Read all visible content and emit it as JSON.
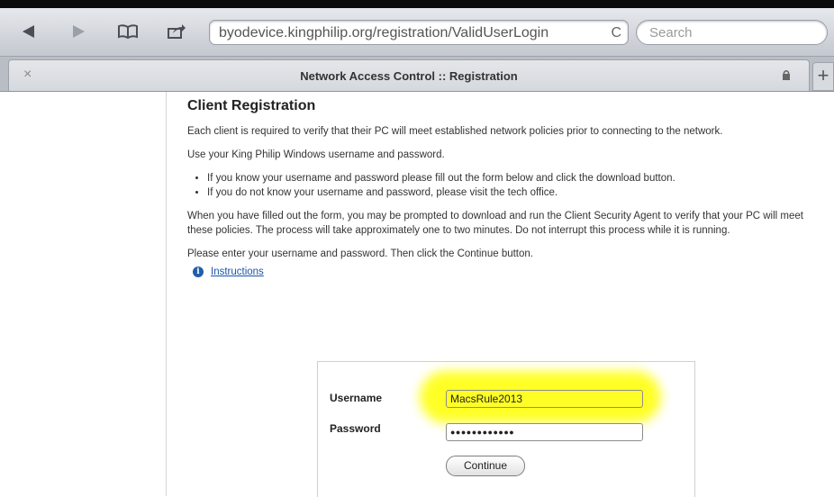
{
  "browser": {
    "url": "byodevice.kingphilip.org/registration/ValidUserLogin",
    "search_placeholder": "Search",
    "tab_title": "Network Access Control :: Registration",
    "tab_close": "×",
    "new_tab": "+",
    "reload_glyph": "C"
  },
  "page": {
    "heading": "Client Registration",
    "intro": "Each client is required to verify that their PC will meet established network policies prior to connecting to the network.",
    "use_creds": "Use your King Philip Windows username and password.",
    "bullets": [
      "If you know your username and password please fill out the form below and click the download button.",
      "If you do not know your username and password, please visit the tech office."
    ],
    "agent_note": "When you have filled out the form, you may be prompted to download and run the Client Security Agent to verify that your PC will meet these policies. The process will take approximately one to two minutes. Do not interrupt this process while it is running.",
    "prompt": "Please enter your username and password. Then click the Continue button.",
    "instructions_link": "Instructions"
  },
  "form": {
    "username_label": "Username",
    "username_value": "MacsRule2013",
    "password_label": "Password",
    "password_value": "●●●●●●●●●●●●",
    "continue_label": "Continue"
  },
  "colors": {
    "highlight": "#ffff00",
    "link": "#1a55a8",
    "info_icon": "#1f5fa8"
  }
}
